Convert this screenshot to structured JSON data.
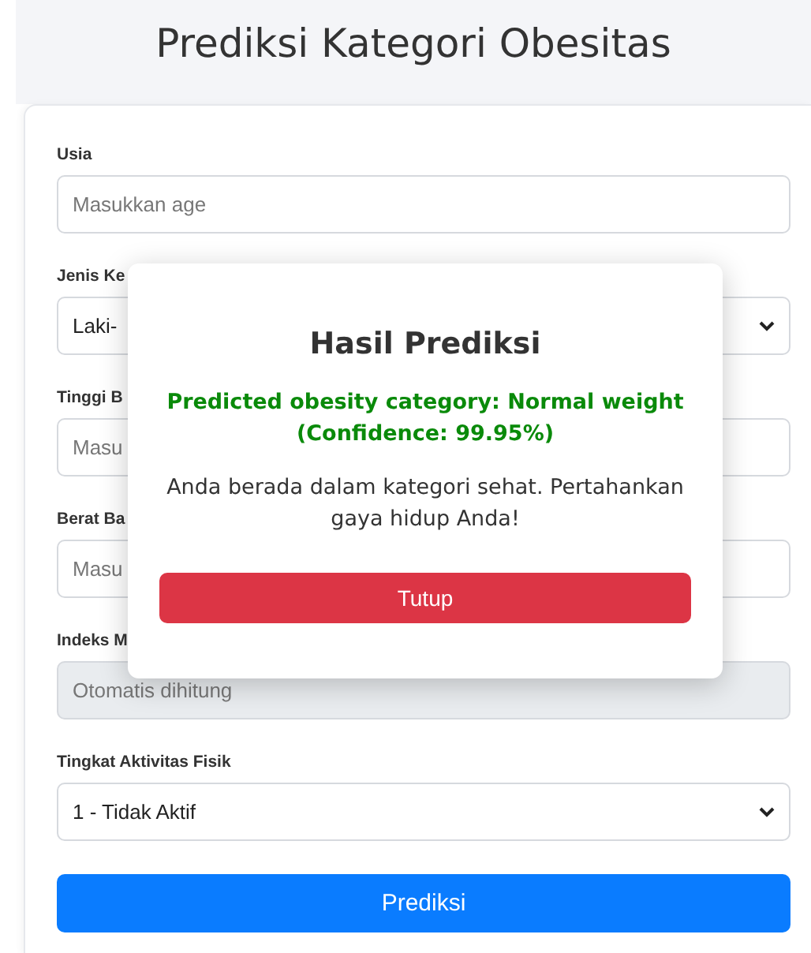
{
  "title": "Prediksi Kategori Obesitas",
  "fields": [
    {
      "label": "Usia",
      "kind": "input",
      "placeholder": "Masukkan age",
      "disabled": false
    },
    {
      "label": "Jenis Ke",
      "kind": "select",
      "value": "Laki-",
      "disabled": false
    },
    {
      "label": "Tinggi B",
      "kind": "input",
      "placeholder": "Masu",
      "disabled": false
    },
    {
      "label": "Berat Ba",
      "kind": "input",
      "placeholder": "Masu",
      "disabled": false
    },
    {
      "label": "Indeks M",
      "kind": "input",
      "placeholder": "Otomatis dihitung",
      "disabled": true
    },
    {
      "label": "Tingkat Aktivitas Fisik",
      "kind": "select",
      "value": "1 - Tidak Aktif",
      "disabled": false
    }
  ],
  "submit_button": "Prediksi",
  "modal": {
    "title": "Hasil Prediksi",
    "result": "Predicted obesity category: Normal weight (Confidence: 99.95%)",
    "message": "Anda berada dalam kategori sehat. Pertahankan gaya hidup Anda!",
    "close_button": "Tutup"
  }
}
